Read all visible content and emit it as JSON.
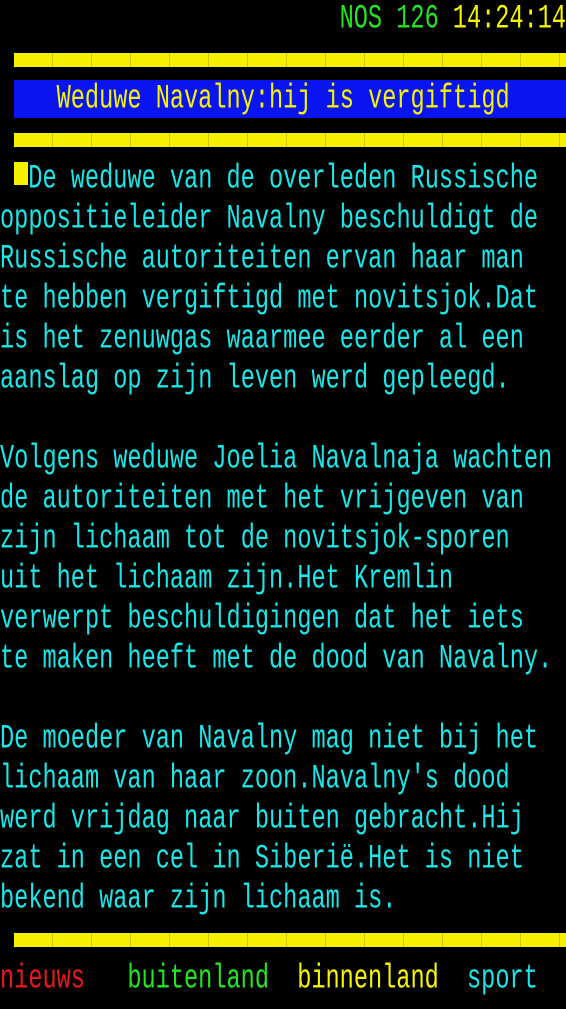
{
  "header": {
    "service": "NOS",
    "page": "126",
    "time": "14:24:14"
  },
  "title": "Weduwe Navalny:hij is vergiftigd",
  "body_lines": [
    "De weduwe van de overleden Russische",
    "oppositieleider Navalny beschuldigt de",
    "Russische autoriteiten ervan haar man",
    "te hebben vergiftigd met novitsjok.Dat",
    "is het zenuwgas waarmee eerder al een",
    "aanslag op zijn leven werd gepleegd.",
    "",
    "Volgens weduwe Joelia Navalnaja wachten",
    "de autoriteiten met het vrijgeven van",
    "zijn lichaam tot de novitsjok-sporen",
    "uit het lichaam zijn.Het Kremlin",
    "verwerpt beschuldigingen dat het iets",
    "te maken heeft met de dood van Navalny.",
    "",
    "De moeder van Navalny mag niet bij het",
    "lichaam van haar zoon.Navalny's dood",
    "werd vrijdag naar buiten gebracht.Hij",
    "zat in een cel in Siberië.Het is niet",
    "bekend waar zijn lichaam is."
  ],
  "nav": {
    "red": "nieuws",
    "green": "buitenland",
    "yellow": "binnenland",
    "cyan": "sport"
  },
  "colors": {
    "background": "#000000",
    "text": "#1ee6e6",
    "accent": "#f5f500",
    "title_bg": "#0a14f0"
  }
}
